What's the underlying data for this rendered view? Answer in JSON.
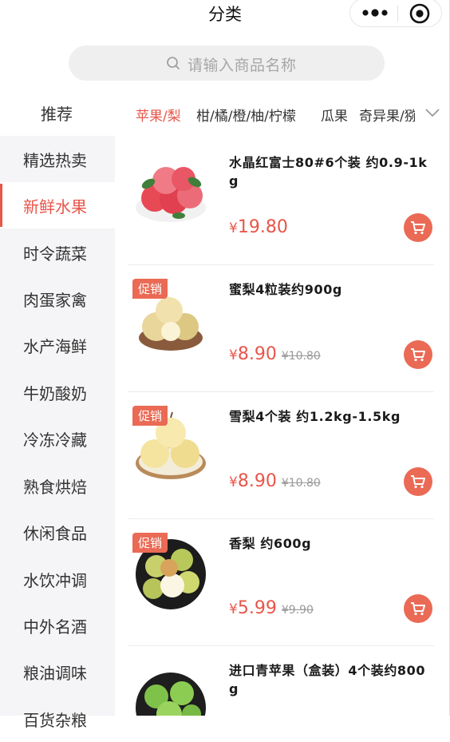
{
  "header": {
    "title": "分类"
  },
  "search": {
    "placeholder": "请输入商品名称"
  },
  "sidebar": {
    "items": [
      {
        "label": "推荐"
      },
      {
        "label": "精选热卖"
      },
      {
        "label": "新鲜水果"
      },
      {
        "label": "时令蔬菜"
      },
      {
        "label": "肉蛋家禽"
      },
      {
        "label": "水产海鲜"
      },
      {
        "label": "牛奶酸奶"
      },
      {
        "label": "冷冻冷藏"
      },
      {
        "label": "熟食烘焙"
      },
      {
        "label": "休闲食品"
      },
      {
        "label": "水饮冲调"
      },
      {
        "label": "中外名酒"
      },
      {
        "label": "粮油调味"
      },
      {
        "label": "百货杂粮"
      }
    ],
    "active_index": 2
  },
  "tabs": {
    "items": [
      {
        "label": "苹果/梨"
      },
      {
        "label": "柑/橘/橙/柚/柠檬"
      },
      {
        "label": "瓜果"
      },
      {
        "label": "奇异果/猕"
      }
    ],
    "active_index": 0
  },
  "products": [
    {
      "name": "水晶红富士80#6个装 约0.9-1kg",
      "currency": "¥",
      "price": "19.80",
      "old_price": "",
      "promo": "",
      "image": "red-apples"
    },
    {
      "name": "蜜梨4粒装约900g",
      "currency": "¥",
      "price": "8.90",
      "old_price": "¥10.80",
      "promo": "促销",
      "image": "honey-pears"
    },
    {
      "name": "雪梨4个装 约1.2kg-1.5kg",
      "currency": "¥",
      "price": "8.90",
      "old_price": "¥10.80",
      "promo": "促销",
      "image": "snow-pears"
    },
    {
      "name": "香梨 约600g",
      "currency": "¥",
      "price": "5.99",
      "old_price": "¥9.90",
      "promo": "促销",
      "image": "fragrant-pears"
    },
    {
      "name": "进口青苹果（盒装）4个装约800g",
      "currency": "¥",
      "price": "",
      "old_price": "",
      "promo": "",
      "image": "green-apples"
    }
  ],
  "colors": {
    "accent": "#e8554a",
    "promo_bg": "#ea6a55",
    "sidebar_bg": "#f5f5f7",
    "search_bg": "#efefef"
  }
}
